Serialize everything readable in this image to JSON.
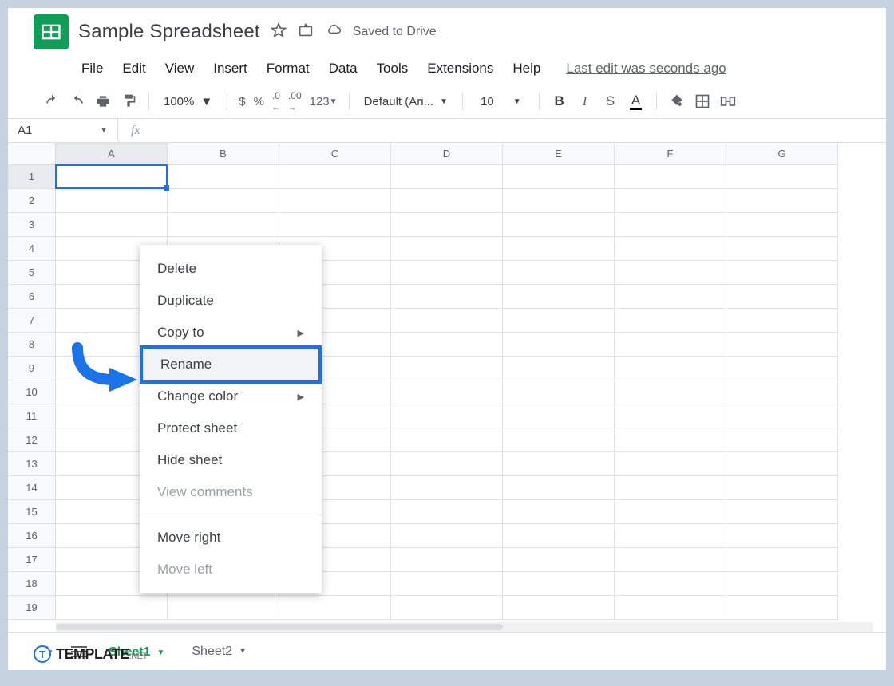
{
  "header": {
    "title": "Sample Spreadsheet",
    "save_status": "Saved to Drive"
  },
  "menu": {
    "file": "File",
    "edit": "Edit",
    "view": "View",
    "insert": "Insert",
    "format": "Format",
    "data": "Data",
    "tools": "Tools",
    "extensions": "Extensions",
    "help": "Help",
    "last_edit": "Last edit was seconds ago"
  },
  "toolbar": {
    "zoom": "100%",
    "currency": "$",
    "percent": "%",
    "dec_dec": ".0",
    "dec_inc": ".00",
    "num_fmt": "123",
    "font": "Default (Ari...",
    "size": "10",
    "bold": "B",
    "italic": "I",
    "strike": "S",
    "color": "A"
  },
  "fx": {
    "name_box": "A1",
    "fx_label": "fx"
  },
  "columns": [
    "A",
    "B",
    "C",
    "D",
    "E",
    "F",
    "G"
  ],
  "rows": [
    "1",
    "2",
    "3",
    "4",
    "5",
    "6",
    "7",
    "8",
    "9",
    "10",
    "11",
    "12",
    "13",
    "14",
    "15",
    "16",
    "17",
    "18",
    "19"
  ],
  "context_menu": {
    "delete": "Delete",
    "duplicate": "Duplicate",
    "copy_to": "Copy to",
    "rename": "Rename",
    "change_color": "Change color",
    "protect": "Protect sheet",
    "hide": "Hide sheet",
    "view_comments": "View comments",
    "move_right": "Move right",
    "move_left": "Move left"
  },
  "sheets": {
    "s1": "Sheet1",
    "s2": "Sheet2"
  },
  "watermark": {
    "badge": "T",
    "text": "TEMPLATE",
    "net": ".NET"
  }
}
